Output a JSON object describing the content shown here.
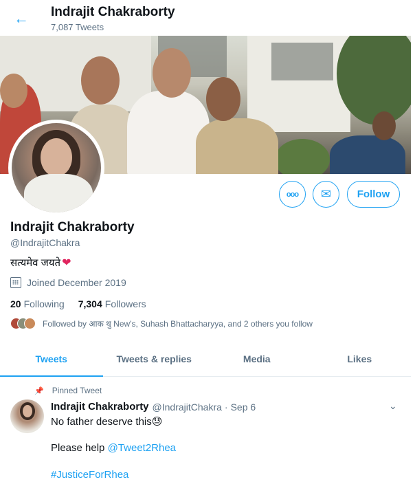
{
  "header": {
    "title": "Indrajit Chakraborty",
    "tweet_count": "7,087 Tweets",
    "back_icon": "←"
  },
  "profile": {
    "name": "Indrajit Chakraborty",
    "handle": "@IndrajitChakra",
    "bio": "सत्यमेव जयते",
    "bio_emoji": "❤",
    "joined": "Joined December 2019",
    "following_count": "20",
    "following_label": "Following",
    "followers_count": "7,304",
    "followers_label": "Followers",
    "followed_by": "Followed by आक थु New's, Suhash Bhattacharyya, and 2 others you follow"
  },
  "actions": {
    "more_icon": "ooo",
    "message_icon": "✉",
    "follow_label": "Follow"
  },
  "tabs": [
    {
      "label": "Tweets",
      "active": true
    },
    {
      "label": "Tweets & replies",
      "active": false
    },
    {
      "label": "Media",
      "active": false
    },
    {
      "label": "Likes",
      "active": false
    }
  ],
  "pinned_tweet": {
    "pinned_label": "Pinned Tweet",
    "author_name": "Indrajit Chakraborty",
    "author_handle": "@IndrajitChakra",
    "separator": "·",
    "date": "Sep 6",
    "line1": "No father deserve this",
    "line1_emoji": "😓",
    "line2_prefix": "Please help",
    "line2_mention": "@Tweet2Rhea",
    "line3_hashtag": "#JusticeForRhea"
  },
  "colors": {
    "accent": "#1da1f2",
    "text": "#0f1419",
    "secondary": "#5b7083",
    "heart": "#e0245e"
  }
}
